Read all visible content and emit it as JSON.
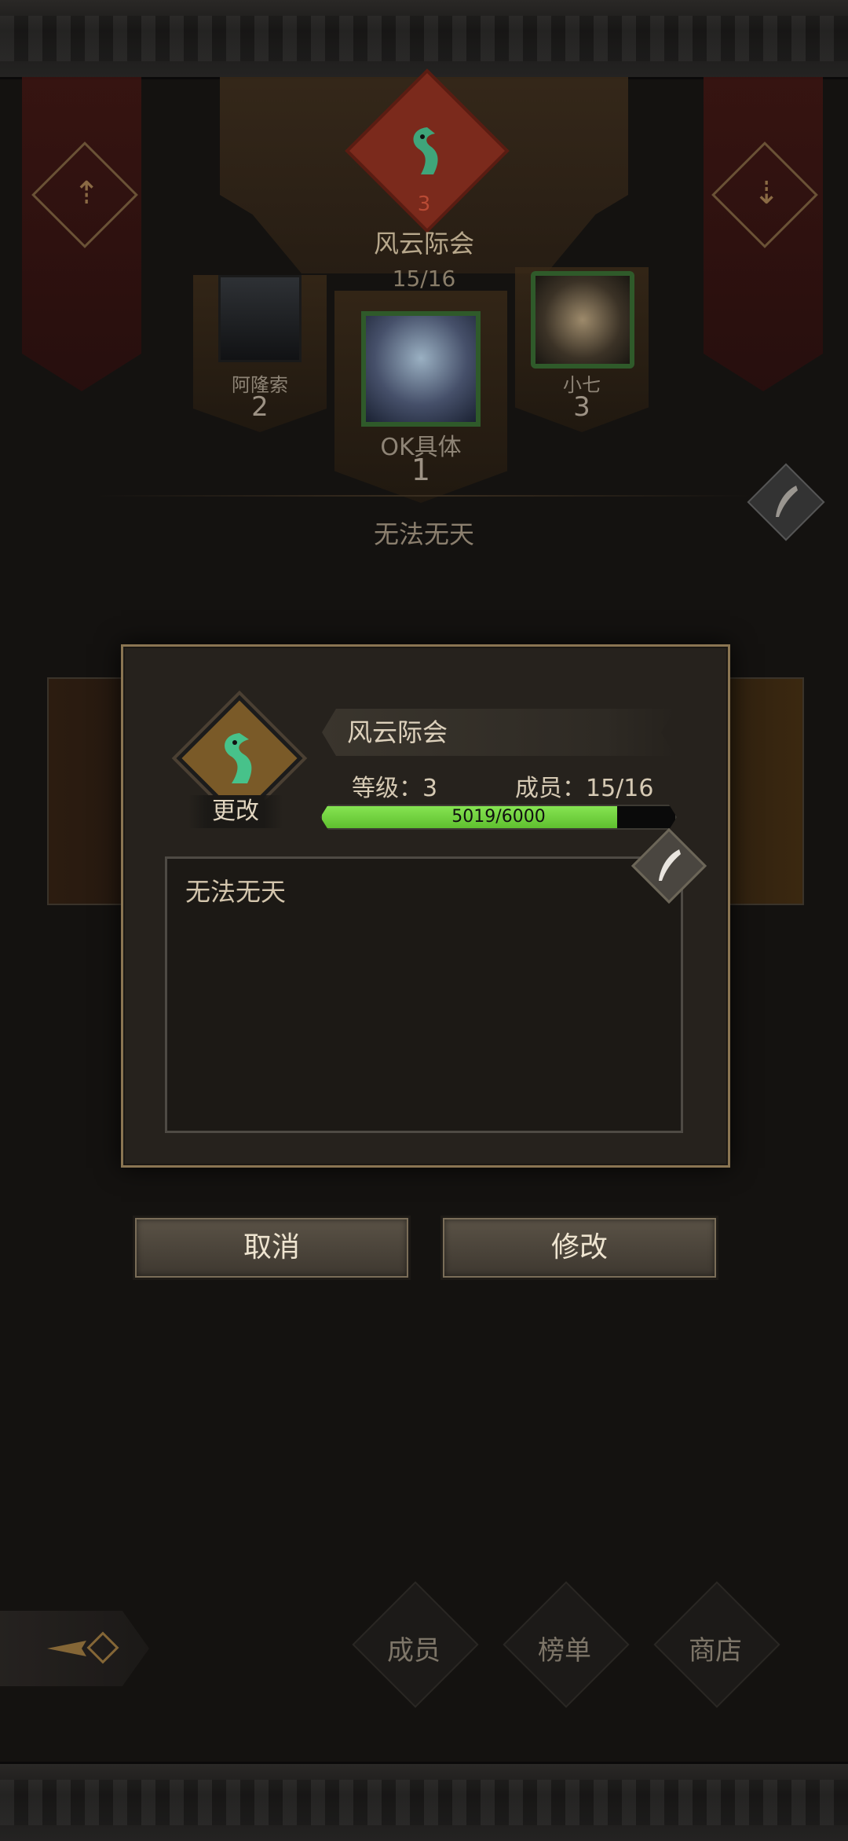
{
  "guild": {
    "name": "风云际会",
    "level": "3",
    "members": "15/16",
    "motto": "无法无天"
  },
  "podium": [
    {
      "name": "阿隆索",
      "rank": "2"
    },
    {
      "name": "OK具体",
      "rank": "1"
    },
    {
      "name": "小七",
      "rank": "3"
    }
  ],
  "modal": {
    "guild_name": "风云际会",
    "level_text": "等级：3",
    "members_text": "成员：15/16",
    "xp_text": "5019/6000",
    "xp_fraction": 0.8365,
    "change_emblem_label": "更改",
    "motto": "无法无天"
  },
  "buttons": {
    "cancel": "取消",
    "confirm": "修改"
  },
  "nav": {
    "members": "成员",
    "ranking": "榜单",
    "shop": "商店"
  },
  "colors": {
    "xp_fill": "#5fbf2f",
    "frame": "#8a7552",
    "banner": "#3c1411"
  }
}
